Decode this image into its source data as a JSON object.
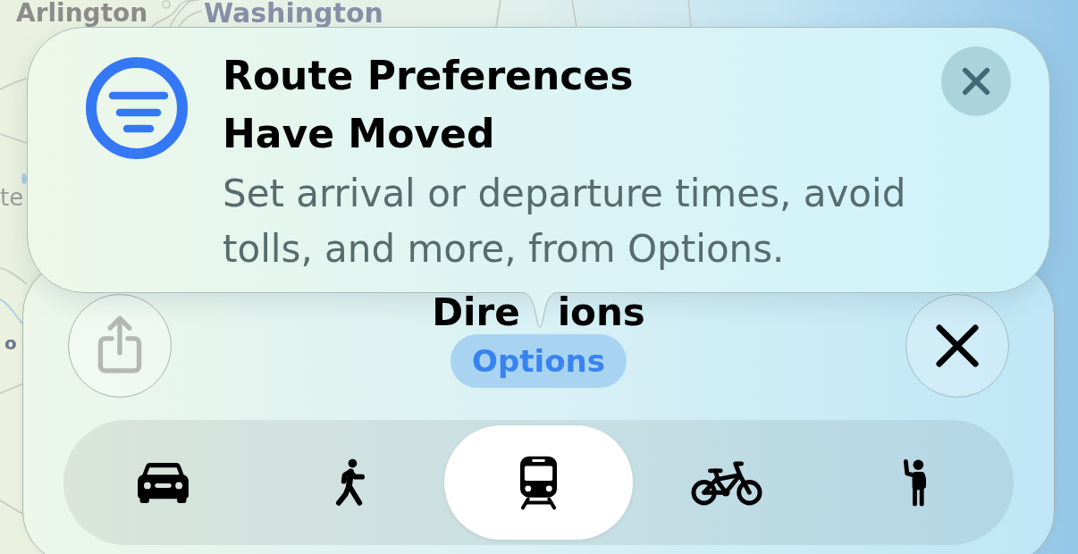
{
  "map": {
    "labels": [
      {
        "text": "Arlington",
        "kind": "town"
      },
      {
        "text": "Washington",
        "kind": "city"
      },
      {
        "text": "te",
        "kind": "area"
      },
      {
        "text": "o",
        "kind": "district"
      }
    ]
  },
  "tip": {
    "title": "Route Preferences Have Moved",
    "message": "Set arrival or departure times, avoid tolls, and more, from Options."
  },
  "sheet": {
    "title_visible_parts": [
      "Dire",
      "ions"
    ],
    "share_button": {
      "disabled": true
    },
    "options_button": "Options",
    "modes": [
      {
        "kind": "car",
        "selected": false
      },
      {
        "kind": "walk",
        "selected": false
      },
      {
        "kind": "transit",
        "selected": true
      },
      {
        "kind": "bike",
        "selected": false
      },
      {
        "kind": "rideshare",
        "selected": false
      }
    ]
  }
}
